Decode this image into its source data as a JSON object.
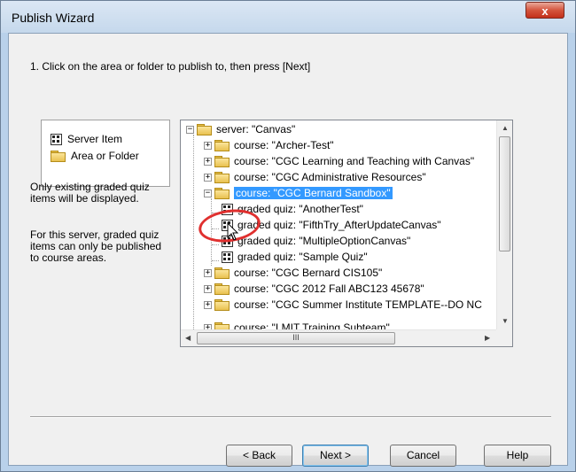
{
  "window": {
    "title": "Publish Wizard",
    "close_glyph": "x"
  },
  "instruction": "1. Click on the area or folder to publish to, then press [Next]",
  "legend": {
    "items": [
      {
        "icon": "server-item-icon",
        "label": "Server Item"
      },
      {
        "icon": "folder-icon",
        "label": "Area or Folder"
      }
    ]
  },
  "notes": {
    "line1": "Only existing graded quiz items will be displayed.",
    "line2": "For this server, graded quiz items can only be published to course areas."
  },
  "tree": {
    "nodes": [
      {
        "label": "server: \"Canvas\"",
        "expander": "−",
        "icon": "folder-icon",
        "level": 0
      },
      {
        "label": "course: \"Archer-Test\"",
        "expander": "+",
        "icon": "folder-icon",
        "level": 1
      },
      {
        "label": "course: \"CGC Learning and Teaching with Canvas\"",
        "expander": "+",
        "icon": "folder-icon",
        "level": 1
      },
      {
        "label": "course: \"CGC Administrative Resources\"",
        "expander": "+",
        "icon": "folder-icon",
        "level": 1
      },
      {
        "label": "course: \"CGC Bernard Sandbox\"",
        "expander": "−",
        "icon": "folder-icon",
        "level": 1,
        "selected": true
      },
      {
        "label": "graded quiz: \"AnotherTest\"",
        "icon": "quiz-icon",
        "level": 2
      },
      {
        "label": "graded quiz: \"FifthTry_AfterUpdateCanvas\"",
        "icon": "quiz-icon",
        "level": 2
      },
      {
        "label": "graded quiz: \"MultipleOptionCanvas\"",
        "icon": "quiz-icon",
        "level": 2
      },
      {
        "label": "graded quiz: \"Sample Quiz\"",
        "icon": "quiz-icon",
        "level": 2
      },
      {
        "label": "course: \"CGC Bernard CIS105\"",
        "expander": "+",
        "icon": "folder-icon",
        "level": 1
      },
      {
        "label": "course: \"CGC 2012 Fall ABC123 45678\"",
        "expander": "+",
        "icon": "folder-icon",
        "level": 1
      },
      {
        "label": "course: \"CGC Summer Institute TEMPLATE--DO NC",
        "expander": "+",
        "icon": "folder-icon",
        "level": 1
      },
      {
        "label": "course: \"LMIT Training Subteam\"",
        "expander": "+",
        "icon": "folder-icon",
        "level": 1
      }
    ],
    "hscroll_grip": "III"
  },
  "buttons": {
    "back": "< Back",
    "next": "Next >",
    "cancel": "Cancel",
    "help": "Help"
  },
  "colors": {
    "selection": "#3399ff",
    "annotation_circle": "#e0302f"
  }
}
